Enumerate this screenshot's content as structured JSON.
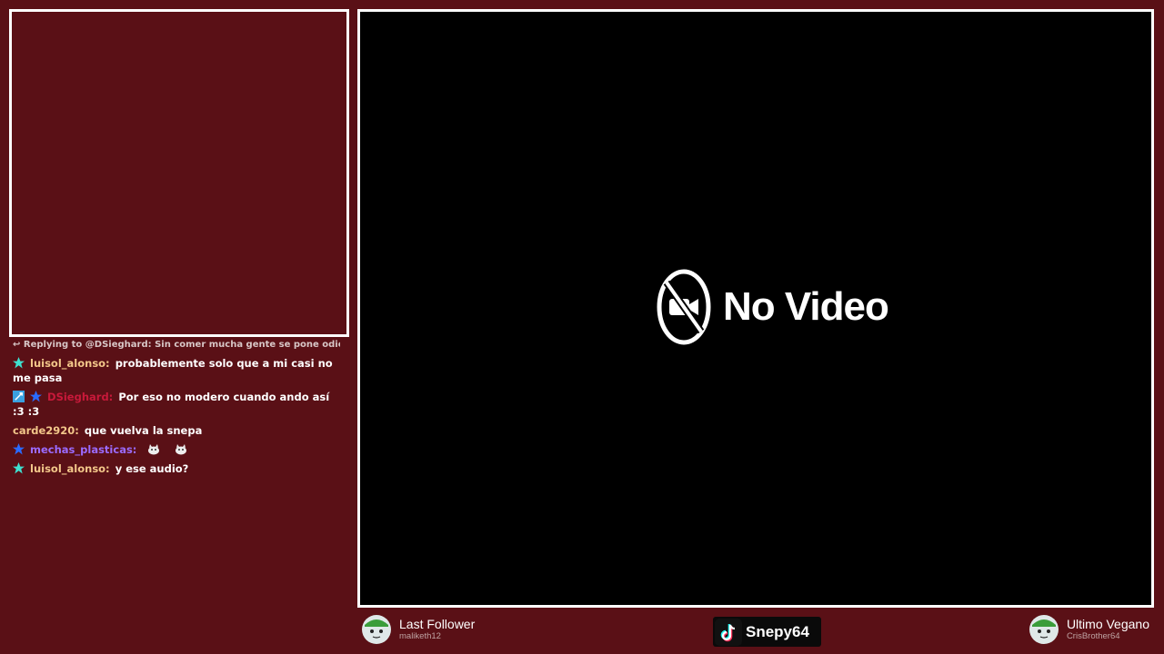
{
  "video": {
    "no_video_label": "No Video"
  },
  "chat": {
    "reply_line": "Replying to @DSieghard: Sin comer mucha gente se pone odiosa",
    "messages": [
      {
        "user": "luisol_alonso:",
        "text": "probablemente solo que a mi casi no me pasa",
        "user_color": "#f3c78a",
        "badges": [
          "star-teal-icon"
        ]
      },
      {
        "user": "DSieghard:",
        "text": "Por eso no modero cuando ando así :3 :3",
        "user_color": "#c8193a",
        "badges": [
          "moderator-sword-icon",
          "star-blue-icon"
        ]
      },
      {
        "user": "carde2920:",
        "text": "que vuelva la snepa",
        "user_color": "#f3c78a",
        "badges": []
      },
      {
        "user": "mechas_plasticas:",
        "text": "",
        "user_color": "#9b6bff",
        "badges": [
          "star-blue-icon"
        ],
        "emotes": [
          "cat-emote-icon",
          "cat-emote-icon"
        ]
      },
      {
        "user": "luisol_alonso:",
        "text": "y ese audio?",
        "user_color": "#f3c78a",
        "badges": [
          "star-teal-icon"
        ]
      }
    ]
  },
  "last_follower": {
    "title": "Last Follower",
    "name": "maliketh12"
  },
  "tiktok": {
    "name": "Snepy64"
  },
  "last_vegan": {
    "title": "Ultimo Vegano",
    "name": "CrisBrother64"
  },
  "colors": {
    "background": "#5a1016",
    "frame": "#ffffff",
    "video_bg": "#000000"
  }
}
